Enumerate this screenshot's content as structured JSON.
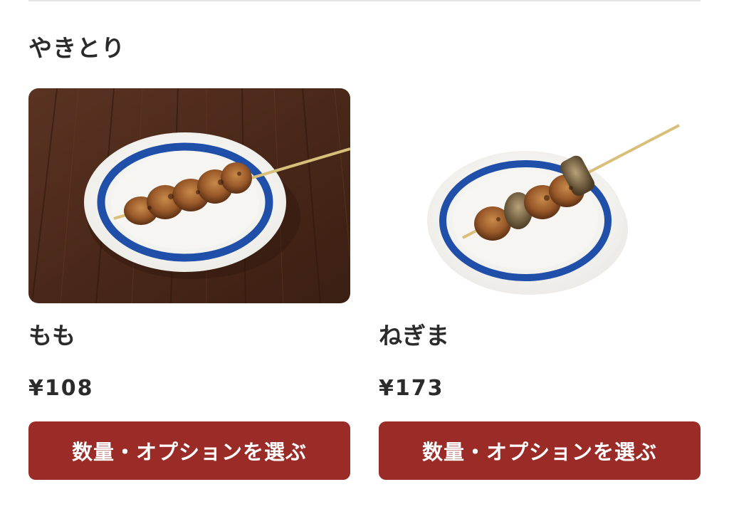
{
  "section": {
    "title": "やきとり"
  },
  "items": [
    {
      "name": "もも",
      "price": "¥108",
      "button_label": "数量・オプションを選ぶ",
      "image_icon": "yakitori-momo-photo"
    },
    {
      "name": "ねぎま",
      "price": "¥173",
      "button_label": "数量・オプションを選ぶ",
      "image_icon": "yakitori-negima-photo"
    }
  ],
  "colors": {
    "button_bg": "#9b2b26",
    "button_text": "#ffffff",
    "text": "#2b2b2b",
    "divider": "#e3e3e3",
    "plate_rim": "#1f4fa8"
  }
}
